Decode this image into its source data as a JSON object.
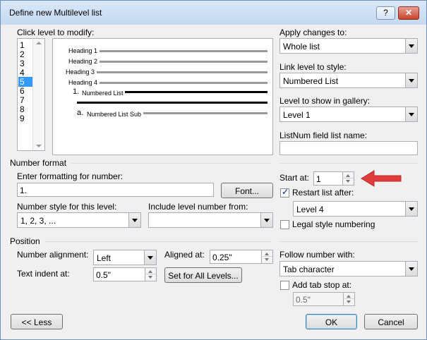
{
  "window": {
    "title": "Define new Multilevel list",
    "help_label": "?",
    "close_label": "✕"
  },
  "levels": {
    "label": "Click level to modify:",
    "items": [
      "1",
      "2",
      "3",
      "4",
      "5",
      "6",
      "7",
      "8",
      "9"
    ],
    "selected": "5"
  },
  "preview": {
    "headings": [
      "Heading 1",
      "Heading 2",
      "Heading 3",
      "Heading 4"
    ],
    "numbered_num": "1.",
    "numbered_text": "Numbered List",
    "sub_num": "a.",
    "sub_text": "Numbered List Sub"
  },
  "apply": {
    "label": "Apply changes to:",
    "value": "Whole list"
  },
  "link": {
    "label": "Link level to style:",
    "value": "Numbered List"
  },
  "gallery": {
    "label": "Level to show in gallery:",
    "value": "Level 1"
  },
  "listnum": {
    "label": "ListNum field list name:",
    "value": ""
  },
  "number_format": {
    "group_label": "Number format",
    "enter_label": "Enter formatting for number:",
    "enter_value": "1.",
    "font_button": "Font...",
    "style_label": "Number style for this level:",
    "style_value": "1, 2, 3, ...",
    "include_label": "Include level number from:",
    "include_value": ""
  },
  "start": {
    "label": "Start at:",
    "value": "1"
  },
  "restart": {
    "label": "Restart list after:",
    "checked": true,
    "value": "Level 4"
  },
  "legal": {
    "label": "Legal style numbering",
    "checked": false
  },
  "position": {
    "group_label": "Position",
    "align_label": "Number alignment:",
    "align_value": "Left",
    "aligned_at_label": "Aligned at:",
    "aligned_at_value": "0.25\"",
    "indent_label": "Text indent at:",
    "indent_value": "0.5\"",
    "set_all_button": "Set for All Levels..."
  },
  "follow": {
    "label": "Follow number with:",
    "value": "Tab character"
  },
  "tabstop": {
    "label": "Add tab stop at:",
    "checked": false,
    "value": "0.5\""
  },
  "buttons": {
    "less": "<< Less",
    "ok": "OK",
    "cancel": "Cancel"
  },
  "colors": {
    "accent": "#3399ff",
    "arrow": "#e03c3c"
  }
}
